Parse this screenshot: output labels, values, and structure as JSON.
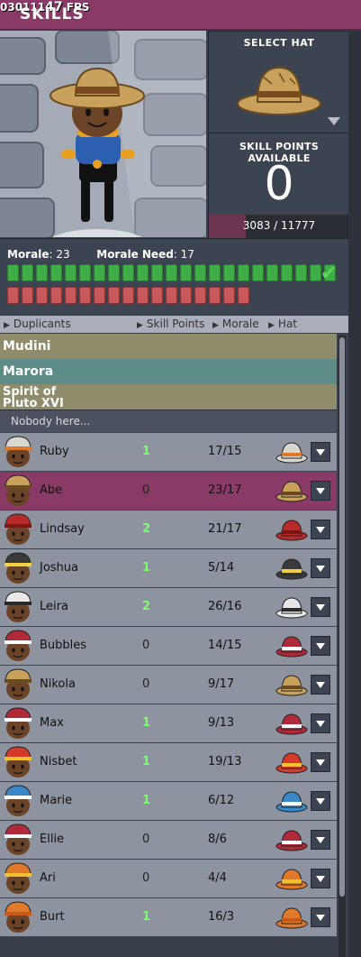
{
  "header": {
    "title": "SKILLS",
    "fps_prefix": "030111",
    "fps_value": "47",
    "fps_label": "FPS"
  },
  "hat_select": {
    "label": "SELECT HAT"
  },
  "skill_points": {
    "label": "SKILL POINTS AVAILABLE",
    "value": "0",
    "xp_text": "3083 / 11777",
    "xp_fraction": 0.26
  },
  "morale": {
    "morale_label": "Morale",
    "morale_value": "23",
    "need_label": "Morale Need",
    "need_value": "17",
    "green_pips": 23,
    "red_pips": 17
  },
  "columns": {
    "duplicants": "Duplicants",
    "skill_points": "Skill Points",
    "morale": "Morale",
    "hat": "Hat"
  },
  "groups": [
    {
      "name": "Mudini"
    },
    {
      "name": "Marora"
    },
    {
      "name": "Spirit of Pluto XVI"
    }
  ],
  "empty_text": "Nobody here...",
  "rows": [
    {
      "name": "Ruby",
      "points": "1",
      "morale": "17/15",
      "hat": "white-hardhat",
      "color": "#d8d8d0",
      "band": "#e07a2a"
    },
    {
      "name": "Abe",
      "points": "0",
      "morale": "23/17",
      "hat": "straw-hat",
      "color": "#c8a25c",
      "band": "#6a4a20"
    },
    {
      "name": "Lindsay",
      "points": "2",
      "morale": "21/17",
      "hat": "red-cap",
      "color": "#b82a2a",
      "band": "#7a1818"
    },
    {
      "name": "Joshua",
      "points": "1",
      "morale": "5/14",
      "hat": "miner-helmet",
      "color": "#3a3a3a",
      "band": "#f0d040"
    },
    {
      "name": "Leira",
      "points": "2",
      "morale": "26/16",
      "hat": "goggles-helmet",
      "color": "#e8e8e8",
      "band": "#2a2a2a"
    },
    {
      "name": "Bubbles",
      "points": "0",
      "morale": "14/15",
      "hat": "medic-helmet",
      "color": "#b02a3a",
      "band": "#ffffff"
    },
    {
      "name": "Nikola",
      "points": "0",
      "morale": "9/17",
      "hat": "straw-hat",
      "color": "#c8a25c",
      "band": "#6a4a20"
    },
    {
      "name": "Max",
      "points": "1",
      "morale": "9/13",
      "hat": "medic-helmet",
      "color": "#b02a3a",
      "band": "#ffffff"
    },
    {
      "name": "Nisbet",
      "points": "1",
      "morale": "19/13",
      "hat": "fire-helmet",
      "color": "#d83a2a",
      "band": "#f0c030"
    },
    {
      "name": "Marie",
      "points": "1",
      "morale": "6/12",
      "hat": "blue-cap",
      "color": "#3a88c8",
      "band": "#ffffff"
    },
    {
      "name": "Ellie",
      "points": "0",
      "morale": "8/6",
      "hat": "medic-helmet",
      "color": "#b02a3a",
      "band": "#ffffff"
    },
    {
      "name": "Ari",
      "points": "0",
      "morale": "4/4",
      "hat": "orange-hardhat",
      "color": "#e07a2a",
      "band": "#f0c030"
    },
    {
      "name": "Burt",
      "points": "1",
      "morale": "16/3",
      "hat": "orange-hardhat",
      "color": "#e07a2a",
      "band": "#c85a1a"
    }
  ],
  "colors": {
    "selected_row": "#8a3a66",
    "row": "#8e93a0",
    "positive_points": "#7cff6a",
    "panel": "#3c4452"
  }
}
